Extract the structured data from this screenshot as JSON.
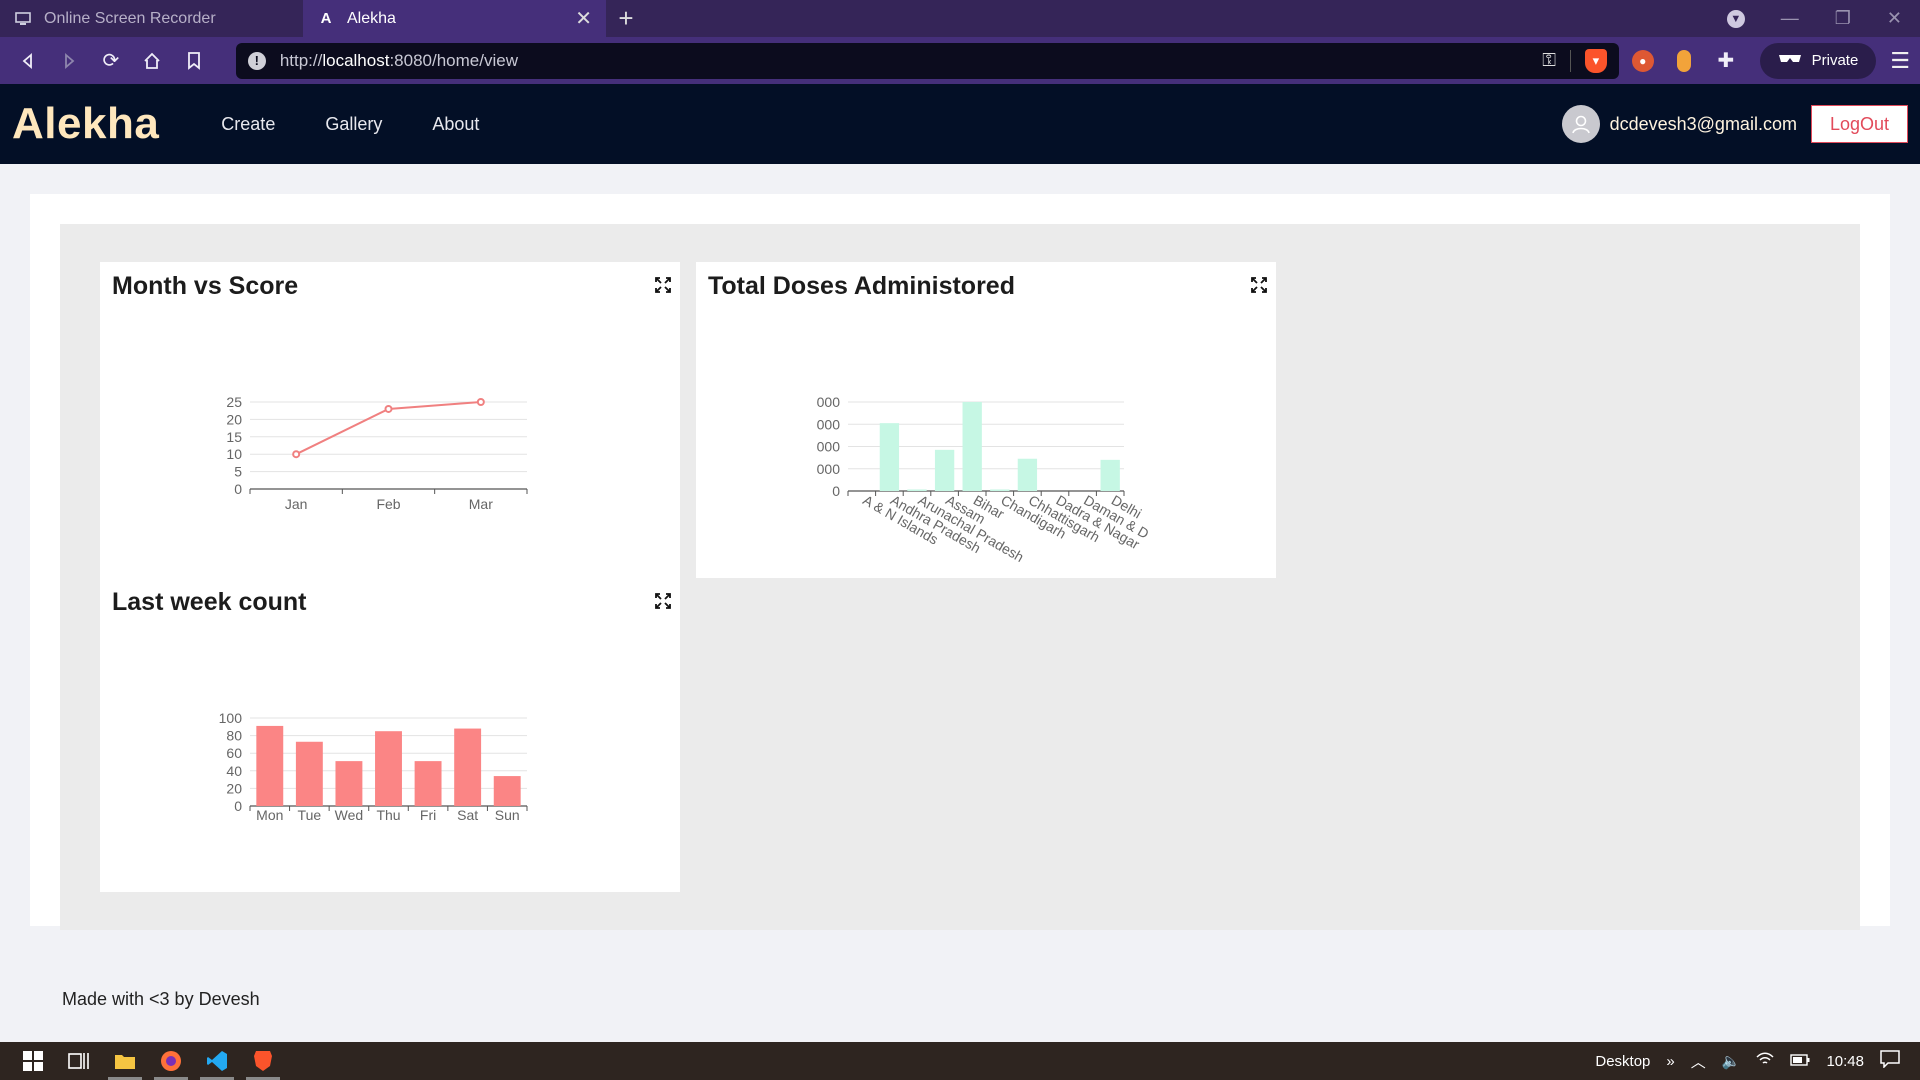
{
  "browser": {
    "tabs": [
      {
        "title": "Online Screen Recorder",
        "active": false
      },
      {
        "title": "Alekha",
        "active": true
      }
    ],
    "url_host": "localhost",
    "url_prefix": "http://",
    "url_suffix": ":8080/home/view",
    "private_label": "Private"
  },
  "app": {
    "brand": "Alekha",
    "nav": [
      "Create",
      "Gallery",
      "About"
    ],
    "user_email": "dcdevesh3@gmail.com",
    "logout_label": "LogOut"
  },
  "panels": {
    "month_score_title": "Month vs Score",
    "doses_title": "Total Doses Administored",
    "week_title": "Last week count"
  },
  "chart_data": [
    {
      "type": "line",
      "title": "Month vs Score",
      "categories": [
        "Jan",
        "Feb",
        "Mar"
      ],
      "values": [
        10,
        23,
        25
      ],
      "yticks": [
        0,
        5,
        10,
        15,
        20,
        25
      ],
      "ylim": [
        0,
        25
      ],
      "color": "#f08080"
    },
    {
      "type": "bar",
      "title": "Total Doses Administored",
      "categories": [
        "A & N Islands",
        "Andhra Pradesh",
        "Arunachal Pradesh",
        "Assam",
        "Bihar",
        "Chandigarh",
        "Chhattisgarh",
        "Dadra & Nagar",
        "Daman & D",
        "Delhi"
      ],
      "values": [
        0,
        3050,
        70,
        1850,
        4000,
        70,
        1450,
        0,
        0,
        1400
      ],
      "ytick_labels": [
        "0",
        "000",
        "000",
        "000",
        "000"
      ],
      "ylim": [
        0,
        4000
      ],
      "color": "#c6f7e4"
    },
    {
      "type": "bar",
      "title": "Last week count",
      "categories": [
        "Mon",
        "Tue",
        "Wed",
        "Thu",
        "Fri",
        "Sat",
        "Sun"
      ],
      "values": [
        91,
        73,
        51,
        85,
        51,
        88,
        34
      ],
      "yticks": [
        0,
        20,
        40,
        60,
        80,
        100
      ],
      "ylim": [
        0,
        100
      ],
      "color": "#fb8585"
    }
  ],
  "footer": "Made with <3 by Devesh",
  "taskbar": {
    "desktop_label": "Desktop",
    "time": "10:48"
  }
}
